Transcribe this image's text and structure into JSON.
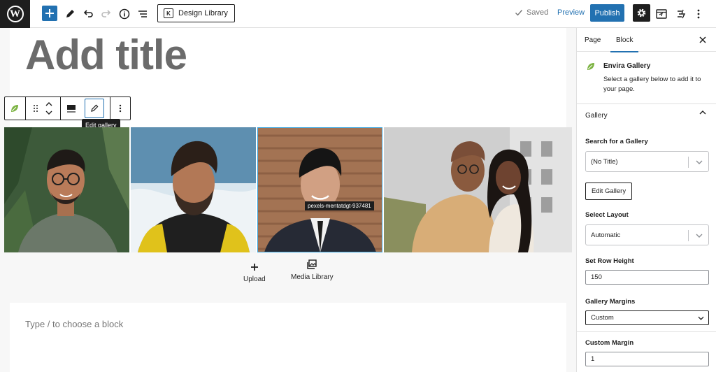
{
  "topbar": {
    "logo_glyph": "W",
    "add_icon": "plus-icon",
    "design_library_label": "Design Library",
    "saved_label": "Saved",
    "preview_label": "Preview",
    "publish_label": "Publish",
    "accent_color": "#2271b1"
  },
  "editor": {
    "title_placeholder": "Add title",
    "toolbar_tooltip": "Edit gallery",
    "image_caption": "pexels-mentatdgt-937481",
    "upload_label": "Upload",
    "media_library_label": "Media Library",
    "block_placeholder": "Type / to choose a block"
  },
  "sidebar": {
    "tabs": [
      "Page",
      "Block"
    ],
    "active_tab": "Block",
    "block_name": "Envira Gallery",
    "block_description": "Select a gallery below to add it to your page.",
    "panel_title": "Gallery",
    "search_label": "Search for a Gallery",
    "search_value": "(No Title)",
    "edit_gallery_label": "Edit Gallery",
    "layout_label": "Select Layout",
    "layout_value": "Automatic",
    "row_height_label": "Set Row Height",
    "row_height_value": "150",
    "margins_label": "Gallery Margins",
    "margins_value": "Custom",
    "custom_margin_label": "Custom Margin",
    "custom_margin_value": "1"
  }
}
